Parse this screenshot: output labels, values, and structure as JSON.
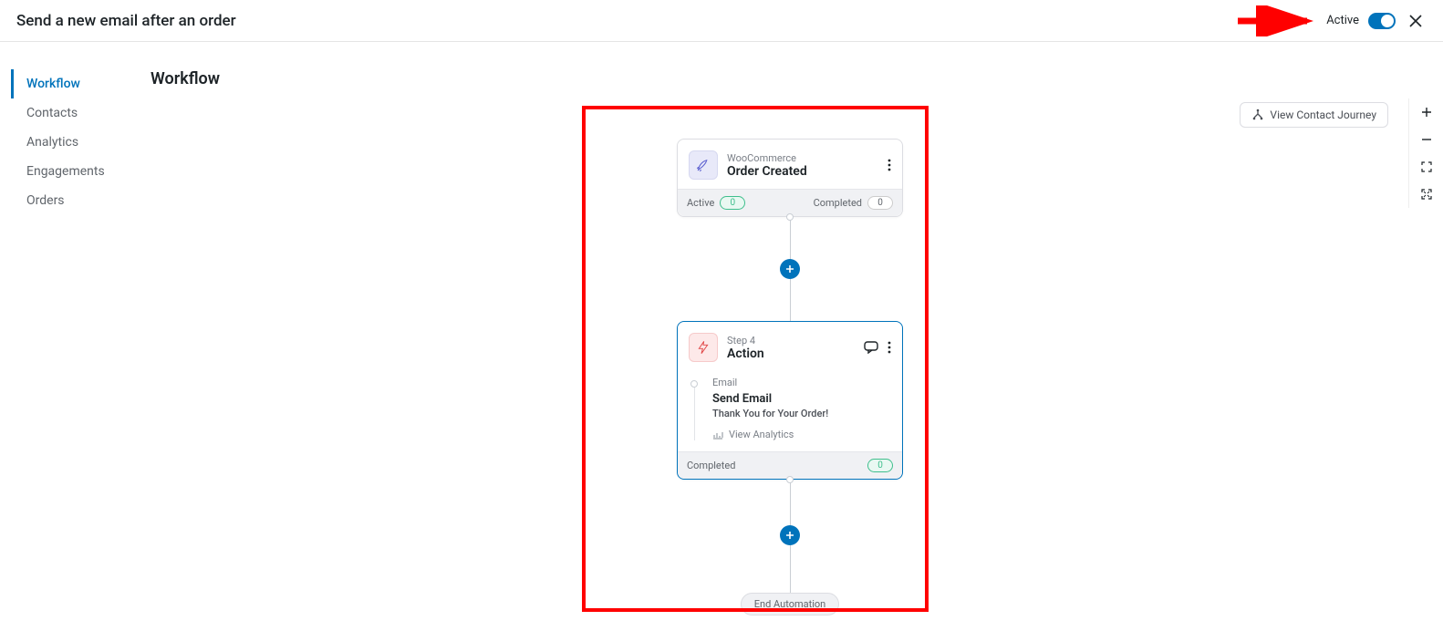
{
  "header": {
    "title": "Send a new email after an order",
    "active_label": "Active",
    "toggle_on": true
  },
  "sidebar": {
    "items": [
      {
        "label": "Workflow",
        "active": true
      },
      {
        "label": "Contacts",
        "active": false
      },
      {
        "label": "Analytics",
        "active": false
      },
      {
        "label": "Engagements",
        "active": false
      },
      {
        "label": "Orders",
        "active": false
      }
    ]
  },
  "page": {
    "title": "Workflow"
  },
  "toolbar": {
    "view_journey": "View Contact Journey"
  },
  "trigger_node": {
    "kicker": "WooCommerce",
    "title": "Order Created",
    "footer": {
      "active_label": "Active",
      "active_count": "0",
      "completed_label": "Completed",
      "completed_count": "0"
    }
  },
  "action_node": {
    "kicker": "Step 4",
    "title": "Action",
    "rows": [
      {
        "kicker": "Email",
        "title": "Send Email",
        "subtitle": "Thank You for Your Order!",
        "link": "View Analytics"
      }
    ],
    "footer": {
      "completed_label": "Completed",
      "completed_count": "0"
    }
  },
  "end": {
    "label": "End Automation"
  }
}
